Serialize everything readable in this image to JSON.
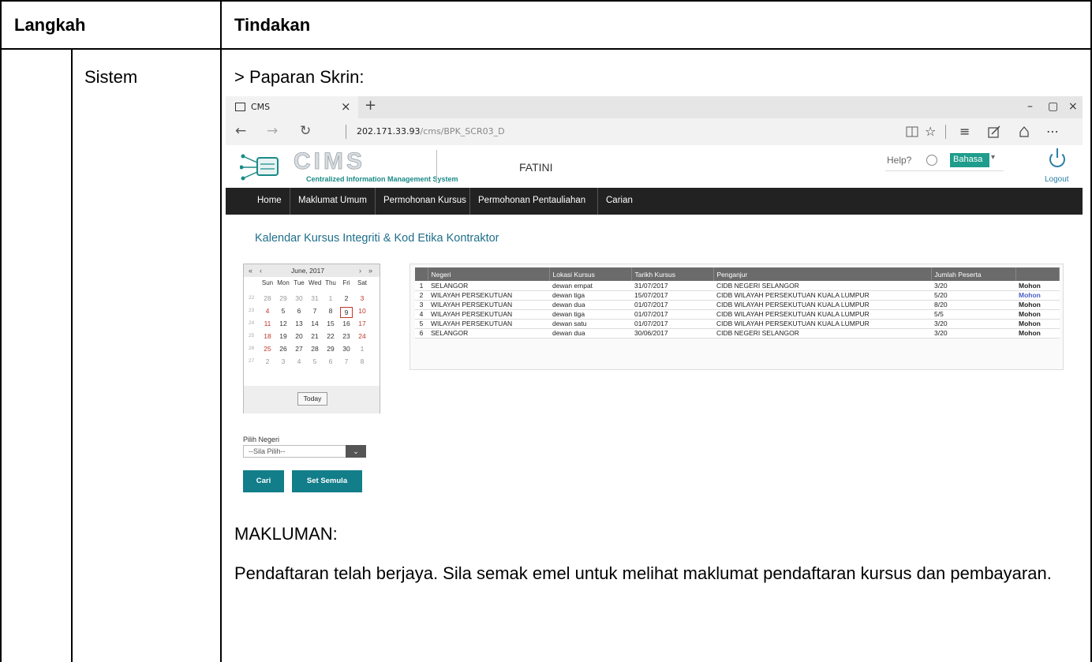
{
  "doc": {
    "col_langkah": "Langkah",
    "col_tindakan": "Tindakan",
    "step_label": "Sistem",
    "screen_label": "> Paparan Skrin:",
    "note_heading": "MAKLUMAN:",
    "note_body": "Pendaftaran telah berjaya. Sila semak emel untuk melihat maklumat pendaftaran kursus dan pembayaran."
  },
  "browser": {
    "tab_title": "CMS",
    "tab_close": "×",
    "new_tab": "+",
    "min": "–",
    "restore": "▢",
    "close": "×",
    "back": "←",
    "forward": "→",
    "refresh": "↻",
    "url_host": "202.171.33.93",
    "url_path": "/cms/BPK_SCR03_D",
    "toolbar_icons": [
      "reading-view-icon",
      "favorite-icon",
      "hub-icon",
      "web-note-icon",
      "share-icon",
      "more-icon"
    ]
  },
  "app": {
    "logo_text": "Centralized Information Management System",
    "user": "FATINI",
    "help": "Help?",
    "language": "Bahasa",
    "logout": "Logout",
    "menu": [
      "Home",
      "Maklumat Umum",
      "Permohonan Kursus",
      "Permohonan Pentauliahan",
      "Carian"
    ],
    "page_title": "Kalendar Kursus Integriti & Kod Etika Kontraktor"
  },
  "calendar": {
    "month": "June, 2017",
    "prev_year": "«",
    "prev_month": "‹",
    "next_month": "›",
    "next_year": "»",
    "dow": [
      "Sun",
      "Mon",
      "Tue",
      "Wed",
      "Thu",
      "Fri",
      "Sat"
    ],
    "weeks": [
      {
        "wk": "22",
        "days": [
          "28",
          "29",
          "30",
          "31",
          "1",
          "2",
          "3"
        ]
      },
      {
        "wk": "23",
        "days": [
          "4",
          "5",
          "6",
          "7",
          "8",
          "9",
          "10"
        ]
      },
      {
        "wk": "24",
        "days": [
          "11",
          "12",
          "13",
          "14",
          "15",
          "16",
          "17"
        ]
      },
      {
        "wk": "25",
        "days": [
          "18",
          "19",
          "20",
          "21",
          "22",
          "23",
          "24"
        ]
      },
      {
        "wk": "26",
        "days": [
          "25",
          "26",
          "27",
          "28",
          "29",
          "30",
          "1"
        ]
      },
      {
        "wk": "27",
        "days": [
          "2",
          "3",
          "4",
          "5",
          "6",
          "7",
          "8"
        ]
      }
    ],
    "today_button": "Today",
    "selected_day": "9"
  },
  "filter": {
    "label": "Pilih Negeri",
    "select_value": "--Sila Pilih--",
    "search_button": "Cari",
    "reset_button": "Set Semula"
  },
  "courses": {
    "headers": [
      "",
      "Negeri",
      "Lokasi Kursus",
      "Tarikh Kursus",
      "Penganjur",
      "Jumlah Peserta",
      ""
    ],
    "rows": [
      [
        "1",
        "SELANGOR",
        "dewan empat",
        "31/07/2017",
        "CIDB NEGERI SELANGOR",
        "3/20",
        "Mohon"
      ],
      [
        "2",
        "WILAYAH PERSEKUTUAN",
        "dewan tiga",
        "15/07/2017",
        "CIDB WILAYAH PERSEKUTUAN KUALA LUMPUR",
        "5/20",
        "Mohon"
      ],
      [
        "3",
        "WILAYAH PERSEKUTUAN",
        "dewan dua",
        "01/07/2017",
        "CIDB WILAYAH PERSEKUTUAN KUALA LUMPUR",
        "8/20",
        "Mohon"
      ],
      [
        "4",
        "WILAYAH PERSEKUTUAN",
        "dewan tiga",
        "01/07/2017",
        "CIDB WILAYAH PERSEKUTUAN KUALA LUMPUR",
        "5/5",
        "Mohon"
      ],
      [
        "5",
        "WILAYAH PERSEKUTUAN",
        "dewan satu",
        "01/07/2017",
        "CIDB WILAYAH PERSEKUTUAN KUALA LUMPUR",
        "3/20",
        "Mohon"
      ],
      [
        "6",
        "SELANGOR",
        "dewan dua",
        "30/06/2017",
        "CIDB NEGERI SELANGOR",
        "3/20",
        "Mohon"
      ]
    ]
  },
  "colors": {
    "teal": "#127e8a",
    "menu_bg": "#222222",
    "link_blue": "#4a5ec8",
    "weekend_red": "#c0392b"
  }
}
